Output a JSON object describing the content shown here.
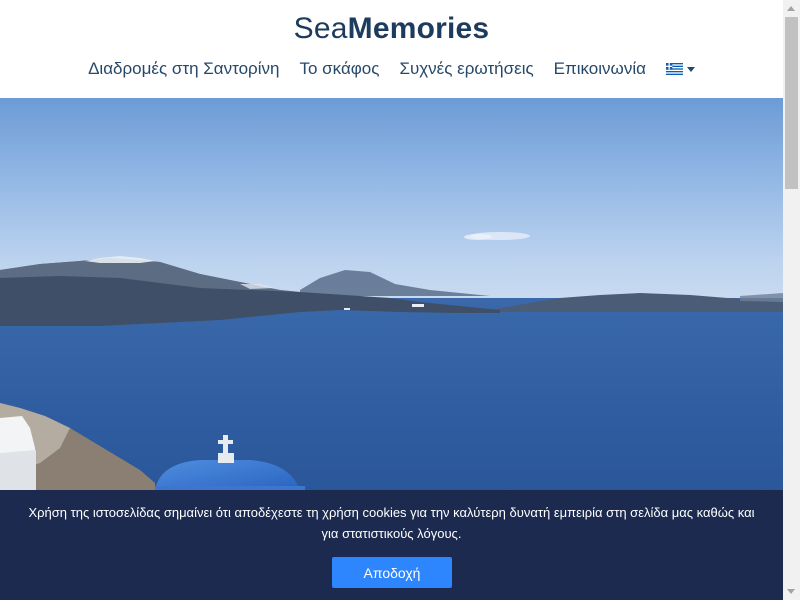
{
  "header": {
    "logo_light": "Sea",
    "logo_bold": "Memories",
    "nav": {
      "tours_label": "Διαδρομές στη Σαντορίνη",
      "boat_label": "Το σκάφος",
      "faq_label": "Συχνές ερωτήσεις",
      "contact_label": "Επικοινωνία"
    },
    "language": {
      "icon": "greek-flag-icon",
      "dropdown_icon": "caret-down-icon"
    }
  },
  "hero": {
    "image": "santorini-caldera-view"
  },
  "cookie_banner": {
    "message": "Χρήση της ιστοσελίδας σημαίνει ότι αποδέχεστε τη χρήση cookies για την καλύτερη δυνατή εμπειρία στη σελίδα μας καθώς και για στατιστικούς λόγους.",
    "accept_label": "Αποδοχή",
    "accept_color": "#2e86ff",
    "background_color": "#1b2a4e"
  },
  "colors": {
    "brand": "#1d3b5c",
    "nav_text": "#26486b",
    "sea": "#2f5ea6"
  }
}
